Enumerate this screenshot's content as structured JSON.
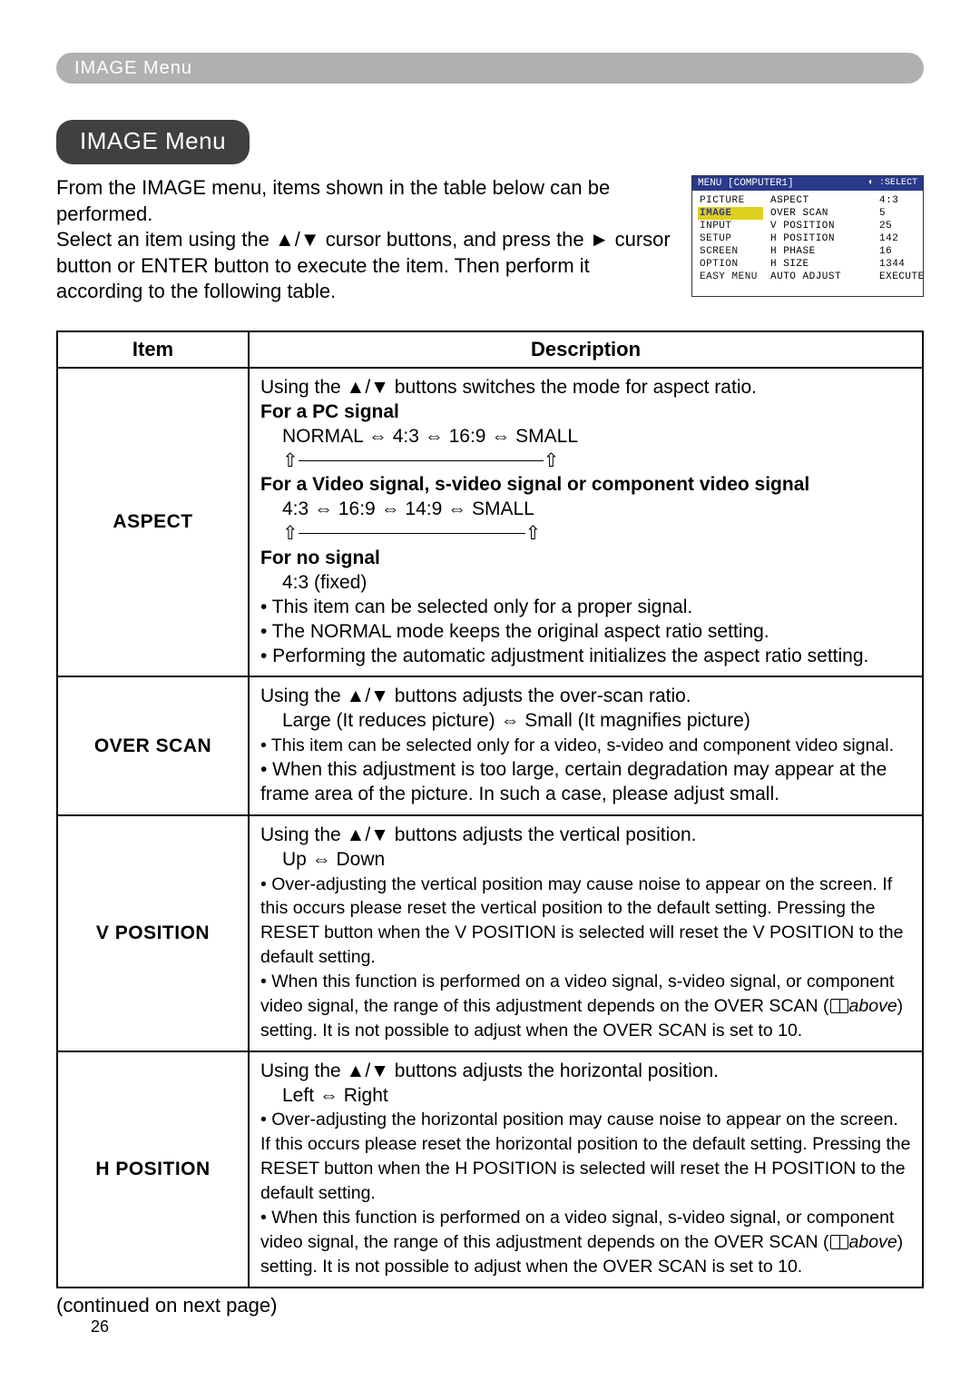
{
  "header": {
    "breadcrumb": "IMAGE Menu"
  },
  "title": "IMAGE Menu",
  "intro": {
    "p1": "From the IMAGE menu, items shown in the table below can be performed.",
    "p2": "Select an item using the ▲/▼ cursor buttons, and press the ► cursor button or ENTER button to execute the item. Then perform it according to the following table."
  },
  "osd": {
    "title_left": "MENU [COMPUTER1]",
    "title_right": ":SELECT",
    "left_items": [
      "PICTURE",
      "IMAGE",
      "INPUT",
      "SETUP",
      "SCREEN",
      "OPTION",
      "EASY MENU"
    ],
    "highlight_index": 1,
    "mid_items": [
      "ASPECT",
      "OVER SCAN",
      "V POSITION",
      "H POSITION",
      "H PHASE",
      "H SIZE",
      "AUTO ADJUST"
    ],
    "right_items": [
      "4:3",
      "5",
      "25",
      "142",
      "16",
      "1344",
      "EXECUTE"
    ]
  },
  "table": {
    "head_item": "Item",
    "head_desc": "Description",
    "rows": [
      {
        "item": "ASPECT",
        "desc": {
          "l1": "Using the ▲/▼ buttons switches the mode for aspect ratio.",
          "h1": "For a PC signal",
          "l2": "NORMAL ⇔ 4:3 ⇔ 16:9 ⇔ SMALL",
          "h2": "For a Video signal, s-video signal or component video signal",
          "l3": "4:3 ⇔ 16:9 ⇔ 14:9 ⇔ SMALL",
          "h3": "For no signal",
          "l4": "4:3 (fixed)",
          "b1": "• This item can be selected only for a proper signal.",
          "b2": "• The NORMAL mode keeps the original aspect ratio setting.",
          "b3": "• Performing the automatic adjustment initializes the aspect ratio setting."
        }
      },
      {
        "item": "OVER SCAN",
        "desc": {
          "l1": "Using the ▲/▼ buttons adjusts the over-scan ratio.",
          "l2": "Large (It reduces picture) ⇔ Small (It magnifies picture)",
          "b1": "• This item can be selected only for a video, s-video and component video signal.",
          "b2": "• When this adjustment is too large, certain degradation may appear at the frame area of the picture. In such a case, please adjust small."
        }
      },
      {
        "item": "V POSITION",
        "desc": {
          "l1": "Using the ▲/▼ buttons adjusts the vertical position.",
          "l2": "Up ⇔ Down",
          "b1": "• Over-adjusting the vertical position may cause noise to appear on the screen. If this occurs please reset the vertical position to the default setting. Pressing the RESET button when the V POSITION is selected will reset the V POSITION to the default setting.",
          "b2a": "• When this function is performed on a video signal, s-video signal, or component video signal, the range of this adjustment depends on the OVER SCAN (",
          "b2b": "above",
          "b2c": ") setting. It is not possible to adjust when the OVER SCAN is set to 10."
        }
      },
      {
        "item": "H POSITION",
        "desc": {
          "l1": "Using the ▲/▼ buttons adjusts the horizontal position.",
          "l2": "Left ⇔ Right",
          "b1": "• Over-adjusting the horizontal position may cause noise to appear on the screen. If this occurs please reset the horizontal position to the default setting. Pressing the RESET button when the H POSITION is selected will reset the H POSITION to the default setting.",
          "b2a": "• When this function is performed on a video signal, s-video signal, or component video signal, the range of this adjustment depends on the OVER SCAN (",
          "b2b": "above",
          "b2c": ") setting. It is not possible to adjust when the OVER SCAN is set to 10."
        }
      }
    ]
  },
  "continued": "(continued on next page)",
  "page_number": "26"
}
